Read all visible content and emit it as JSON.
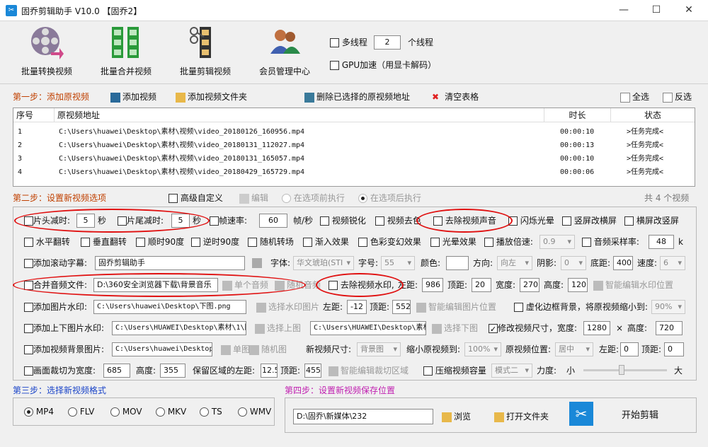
{
  "window": {
    "title": "固乔剪辑助手 V10.0 【固乔2】",
    "min": "—",
    "max": "☐",
    "close": "✕"
  },
  "toolbar": {
    "buttons": [
      {
        "label": "批量转换视频",
        "color": "#7a6a8a"
      },
      {
        "label": "批量合并视频",
        "color": "#2a9a3a"
      },
      {
        "label": "批量剪辑视频",
        "color": "#3a3a3a"
      },
      {
        "label": "会员管理中心",
        "color": "#b05a20"
      }
    ],
    "multithread_label": "多线程",
    "thread_count": "2",
    "thread_unit": "个线程",
    "gpu_label": "GPU加速（用显卡解码）"
  },
  "step1": {
    "title": "第一步：添加原视频",
    "add_video": "添加视频",
    "add_folder": "添加视频文件夹",
    "delete_selected": "删除已选择的原视频地址",
    "clear_table": "清空表格",
    "select_all": "全选",
    "invert": "反选"
  },
  "table": {
    "headers": [
      "序号",
      "原视频地址",
      "时长",
      "状态"
    ],
    "rows": [
      {
        "idx": "1",
        "path": "C:\\Users\\huawei\\Desktop\\素材\\视频\\video_20180126_160956.mp4",
        "duration": "00:00:10",
        "status": ">任务完成<"
      },
      {
        "idx": "2",
        "path": "C:\\Users\\huawei\\Desktop\\素材\\视频\\video_20180131_112027.mp4",
        "duration": "00:00:13",
        "status": ">任务完成<"
      },
      {
        "idx": "3",
        "path": "C:\\Users\\huawei\\Desktop\\素材\\视频\\video_20180131_165057.mp4",
        "duration": "00:00:10",
        "status": ">任务完成<"
      },
      {
        "idx": "4",
        "path": "C:\\Users\\huawei\\Desktop\\素材\\视频\\video_20180429_165729.mp4",
        "duration": "00:00:06",
        "status": ">任务完成<"
      }
    ]
  },
  "step2": {
    "title": "第二步：设置新视频选项",
    "advanced": "高级自定义",
    "edit": "编辑",
    "before": "在选项前执行",
    "after": "在选项后执行",
    "count": "共 4 个视频"
  },
  "opts": {
    "head_cut": "片头减时:",
    "head_val": "5",
    "sec1": "秒",
    "tail_cut": "片尾减时:",
    "tail_val": "5",
    "sec2": "秒",
    "fps": "帧速率:",
    "fps_val": "60",
    "fps_unit": "帧/秒",
    "sharpen": "视频锐化",
    "delogo": "视频去色",
    "remove_audio": "去除视频声音",
    "flash": "闪烁光晕",
    "v2h": "竖屏改横屏",
    "h2v": "横屏改竖屏",
    "hflip": "水平翻转",
    "vflip": "垂直翻转",
    "cw90": "顺时90度",
    "ccw90": "逆时90度",
    "random": "随机转场",
    "fadein": "渐入效果",
    "color_shift": "色彩变幻效果",
    "halo": "光晕效果",
    "speed": "播放倍速:",
    "speed_val": "0.9",
    "samplerate": "音频采样率:",
    "samplerate_val": "48",
    "sr_unit": "k",
    "subtitle": "添加滚动字幕:",
    "subtitle_val": "固乔剪辑助手",
    "font": "字体:",
    "font_val": "华文琥珀(STI",
    "fontsize": "字号:",
    "fontsize_val": "55",
    "color": "颜色:",
    "direction": "方向:",
    "dir_val": "向左",
    "shadow": "阴影:",
    "shadow_val": "0",
    "bottom": "底距:",
    "bottom_val": "400",
    "spd": "速度:",
    "spd_val": "6",
    "merge_audio": "合并音频文件:",
    "merge_audio_val": "D:\\360安全浏览器下载\\背景音乐",
    "single_audio": "单个音频",
    "random_audio": "随机音频",
    "remove_wm": "去除视频水印,",
    "left": "左距:",
    "left_val": "986",
    "top": "顶距:",
    "top_val": "20",
    "width": "宽度:",
    "width_val": "270",
    "height": "高度:",
    "height_val": "120",
    "smart_wm": "智能编辑水印位置",
    "img_wm": "添加图片水印:",
    "img_wm_val": "C:\\Users\\huawei\\Desktop\\下图.png",
    "choose_wm": "选择水印图片",
    "img_left": "左距:",
    "img_left_val": "-12",
    "img_top": "顶距:",
    "img_top_val": "552",
    "smart_img": "智能编辑图片位置",
    "blur": "虚化边框背景，将原视频缩小到:",
    "blur_val": "90%",
    "updown": "添加上下图片水印:",
    "up_val": "C:\\Users\\HUAWEI\\Desktop\\素材\\1\\图",
    "choose_up": "选择上图",
    "down_val": "C:\\Users\\HUAWEI\\Desktop\\素材",
    "choose_down": "选择下图",
    "resize": "修改视频尺寸，宽度:",
    "resize_w": "1280",
    "times": "×",
    "resize_h_lbl": "高度:",
    "resize_h": "720",
    "bgimg": "添加视频背景图片:",
    "bgimg_val": "C:\\Users\\huawei\\Desktop\\",
    "single_img": "单图",
    "random_img": "随机图",
    "newsize": "新视频尺寸:",
    "newsize_val": "背景图",
    "shrink": "缩小原视频到:",
    "shrink_val": "100%",
    "pos": "原视频位置:",
    "pos_val": "居中",
    "bg_left": "左距:",
    "bg_left_val": "0",
    "bg_top": "顶距:",
    "bg_top_val": "0",
    "crop": "画面裁切为宽度:",
    "crop_w": "685",
    "crop_h_lbl": "高度:",
    "crop_h": "355",
    "keep_left": "保留区域的左距:",
    "keep_left_val": "12.5",
    "keep_top": "顶距:",
    "keep_top_val": "455",
    "smart_crop": "智能编辑裁切区域",
    "compress": "压缩视频容量",
    "mode_val": "模式二",
    "strength": "力度:",
    "small": "小",
    "big": "大"
  },
  "step3": {
    "title": "第三步：选择新视频格式",
    "formats": [
      "MP4",
      "FLV",
      "MOV",
      "MKV",
      "TS",
      "WMV"
    ]
  },
  "step4": {
    "title": "第四步：设置新视频保存位置",
    "path": "D:\\固乔\\新媒体\\232",
    "browse": "浏览",
    "open": "打开文件夹",
    "start": "开始剪辑"
  }
}
